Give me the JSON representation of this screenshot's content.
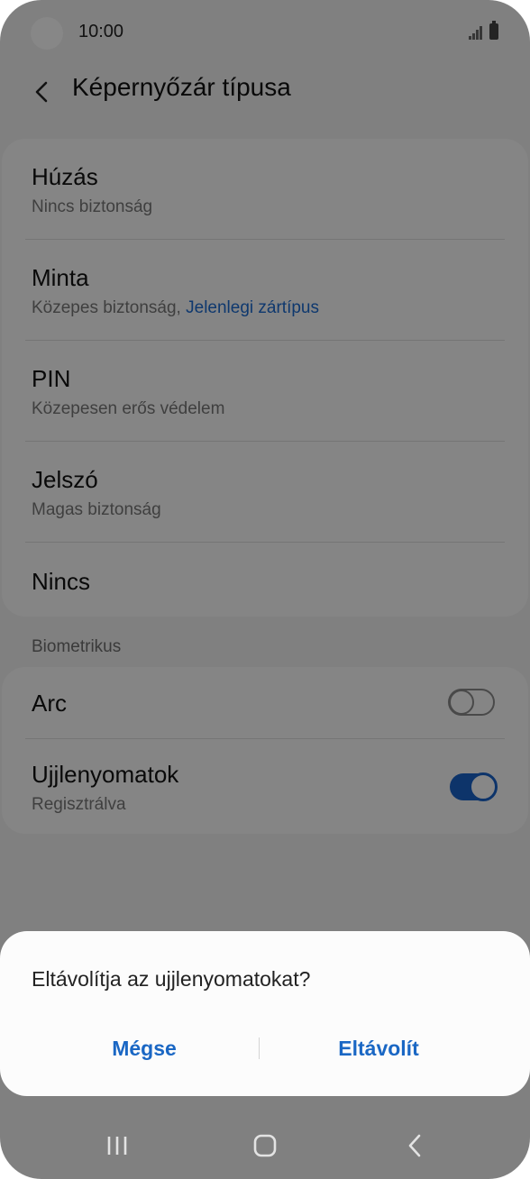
{
  "status_bar": {
    "time": "10:00"
  },
  "header": {
    "title": "Képernyőzár típusa"
  },
  "lock_types": [
    {
      "title": "Húzás",
      "subtitle": "Nincs biztonság"
    },
    {
      "title": "Minta",
      "subtitle": "Közepes biztonság, ",
      "subtitle_accent": "Jelenlegi zártípus"
    },
    {
      "title": "PIN",
      "subtitle": "Közepesen erős védelem"
    },
    {
      "title": "Jelszó",
      "subtitle": "Magas biztonság"
    },
    {
      "title": "Nincs"
    }
  ],
  "biometrics": {
    "header": "Biometrikus",
    "items": [
      {
        "title": "Arc",
        "enabled": false
      },
      {
        "title": "Ujjlenyomatok",
        "subtitle": "Regisztrálva",
        "enabled": true
      }
    ]
  },
  "dialog": {
    "message": "Eltávolítja az ujjlenyomatokat?",
    "cancel_label": "Mégse",
    "confirm_label": "Eltávolít"
  },
  "colors": {
    "accent": "#1a67c4",
    "scrim": "#000000"
  },
  "icons": {
    "back": "back-arrow-icon",
    "nav_recents": "recents-icon",
    "nav_home": "home-icon",
    "nav_back": "nav-back-icon"
  }
}
